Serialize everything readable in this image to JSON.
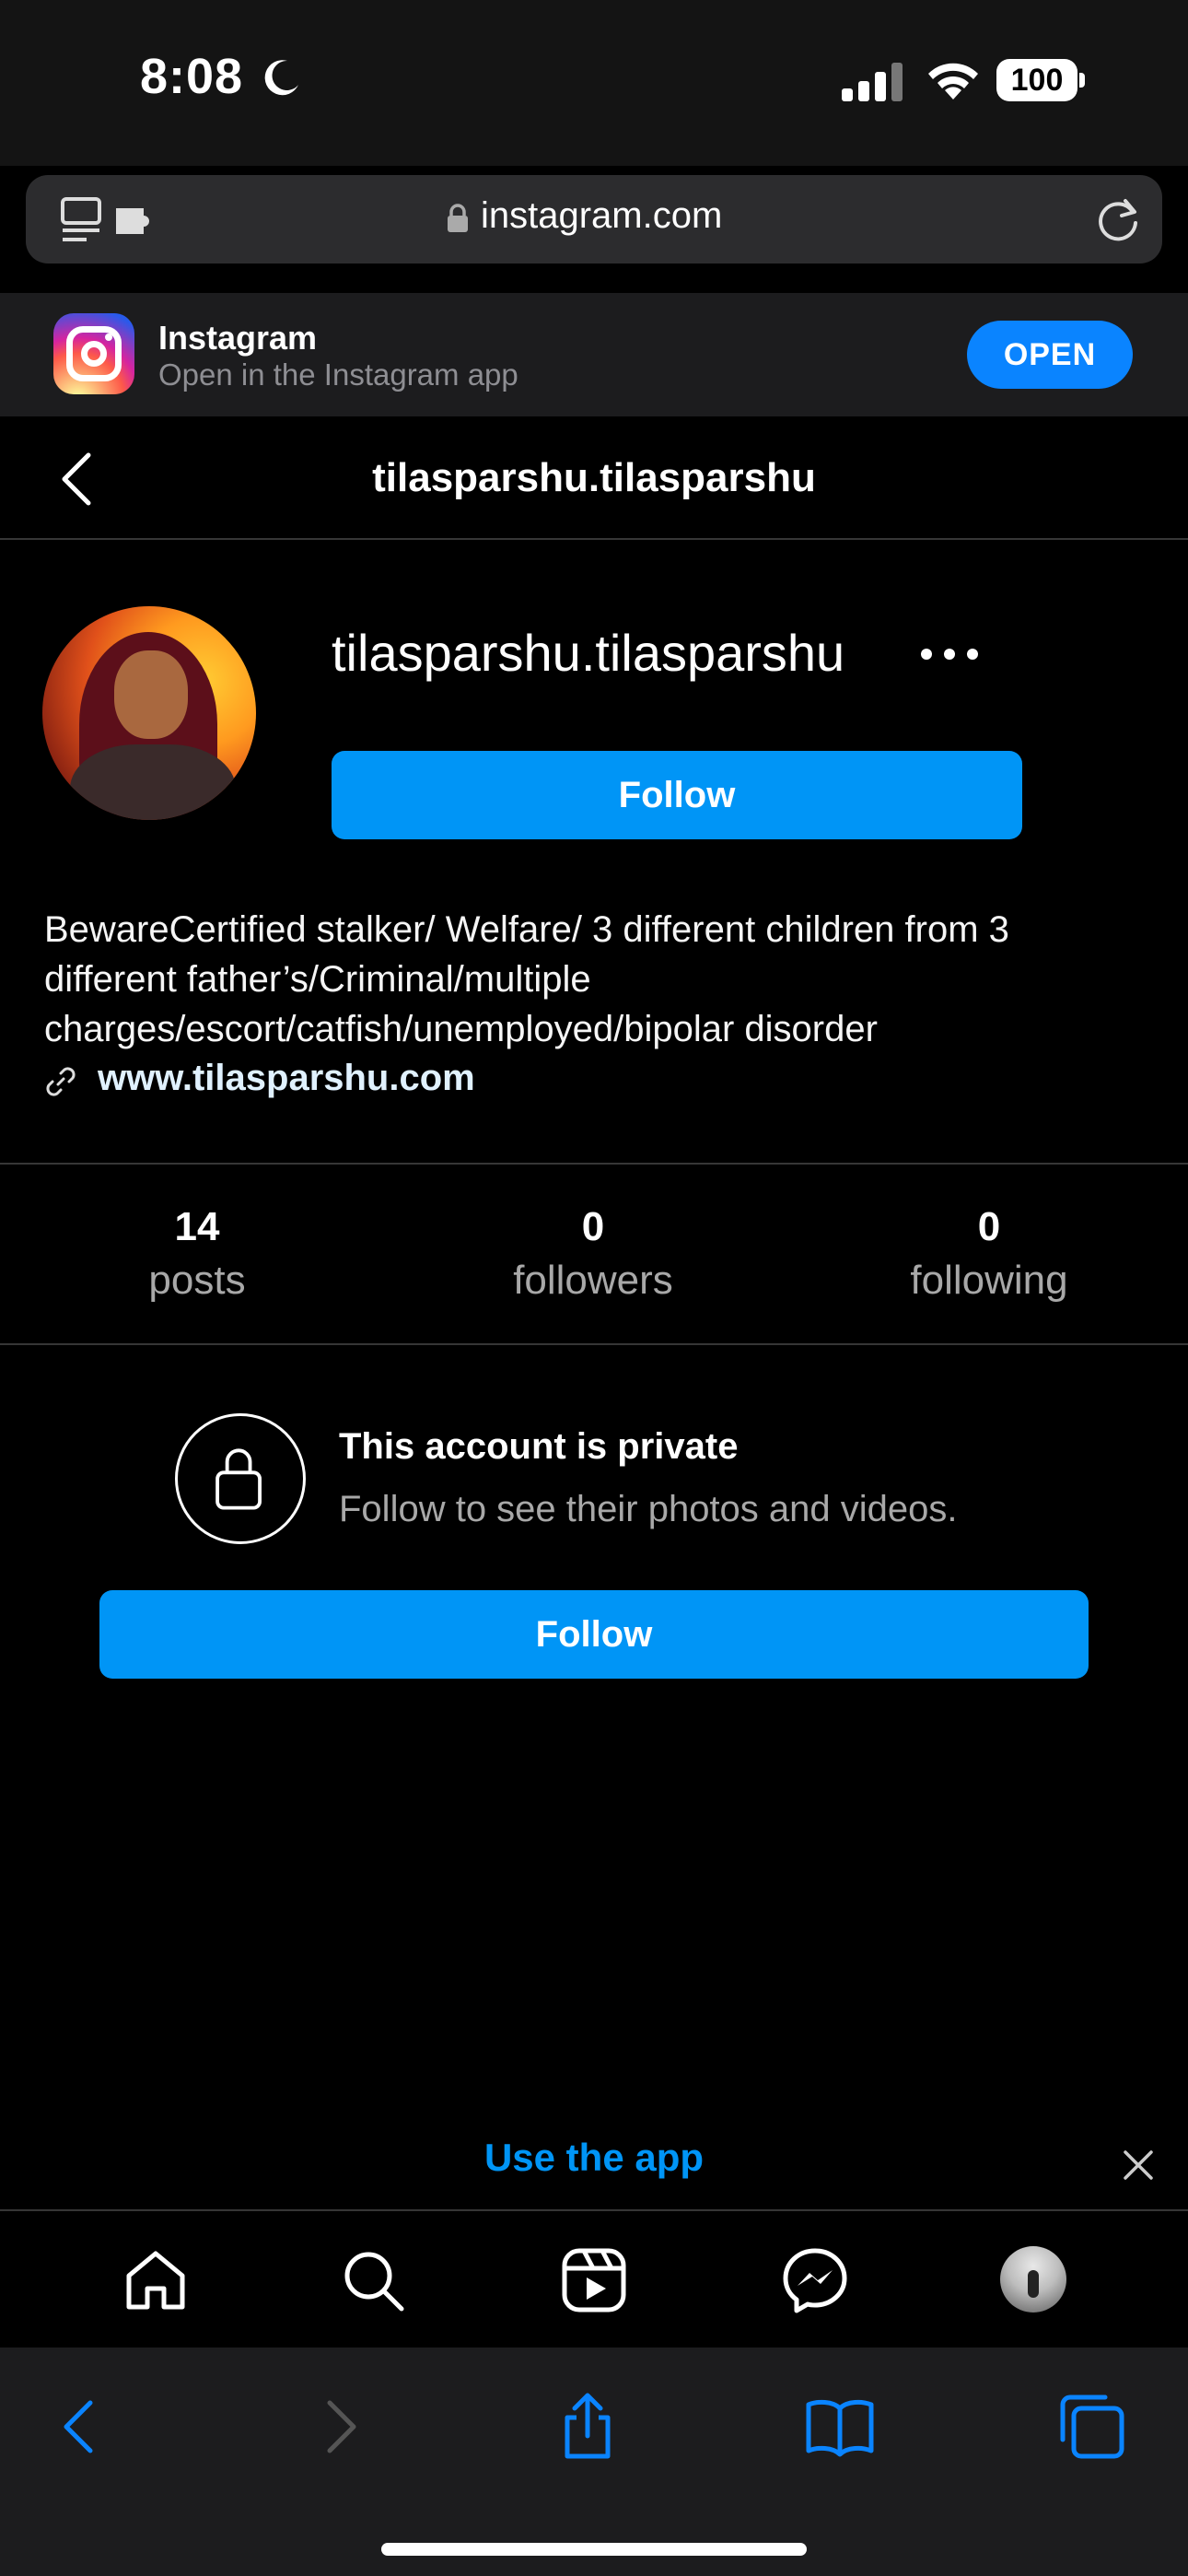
{
  "status_bar": {
    "time": "8:08",
    "battery": "100",
    "icons": [
      "moon-icon",
      "cellular-signal-icon",
      "wifi-icon",
      "battery-icon"
    ]
  },
  "browser": {
    "url": "instagram.com",
    "icons": [
      "reader-extensions-icon",
      "lock-icon",
      "reload-icon"
    ]
  },
  "app_banner": {
    "app_name": "Instagram",
    "subtitle": "Open in the Instagram app",
    "open_label": "OPEN"
  },
  "header": {
    "title": "tilasparshu.tilasparshu"
  },
  "profile": {
    "username": "tilasparshu.tilasparshu",
    "follow_label": "Follow",
    "bio": "BewareCertified stalker/ Welfare/ 3 different children from 3 different father’s/Criminal/multiple charges/escort/catfish/unemployed/bipolar disorder",
    "website": "www.tilasparshu.com"
  },
  "stats": [
    {
      "value": "14",
      "label": "posts"
    },
    {
      "value": "0",
      "label": "followers"
    },
    {
      "value": "0",
      "label": "following"
    }
  ],
  "private_notice": {
    "title": "This account is private",
    "subtitle": "Follow to see their photos and videos.",
    "follow_label": "Follow"
  },
  "use_app": {
    "label": "Use the app"
  },
  "ig_nav": [
    "home-icon",
    "search-icon",
    "reels-icon",
    "messenger-icon",
    "profile-avatar"
  ],
  "safari_toolbar": [
    "back-icon",
    "forward-icon",
    "share-icon",
    "bookmarks-icon",
    "tabs-icon"
  ],
  "colors": {
    "accent_blue": "#0095f6",
    "safari_blue": "#0a84ff",
    "background": "#000000",
    "divider": "#363636",
    "secondary_text": "#a8a8a8"
  }
}
